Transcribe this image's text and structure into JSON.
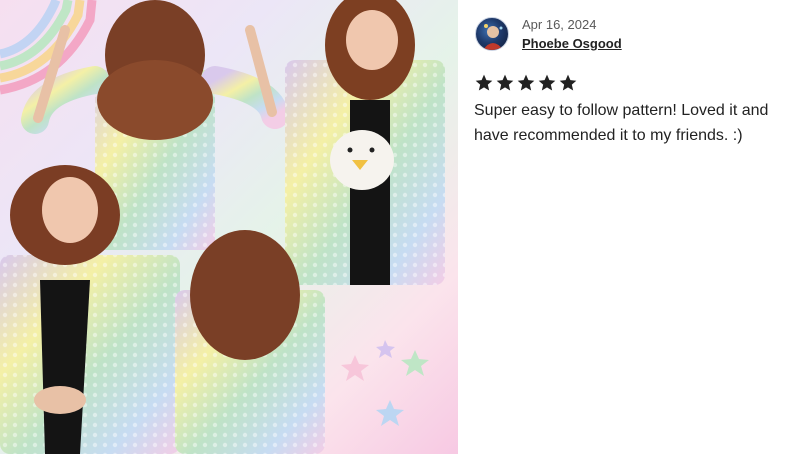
{
  "review": {
    "date": "Apr 16, 2024",
    "reviewer_name": "Phoebe Osgood",
    "rating": 5,
    "text": "Super easy to follow pattern! Loved it and have recommended it to my friends. :)"
  },
  "icons": {
    "avatar": "reviewer-avatar-icon",
    "star": "star-icon"
  },
  "colors": {
    "star": "#222222",
    "text": "#222222",
    "date": "#595959"
  }
}
